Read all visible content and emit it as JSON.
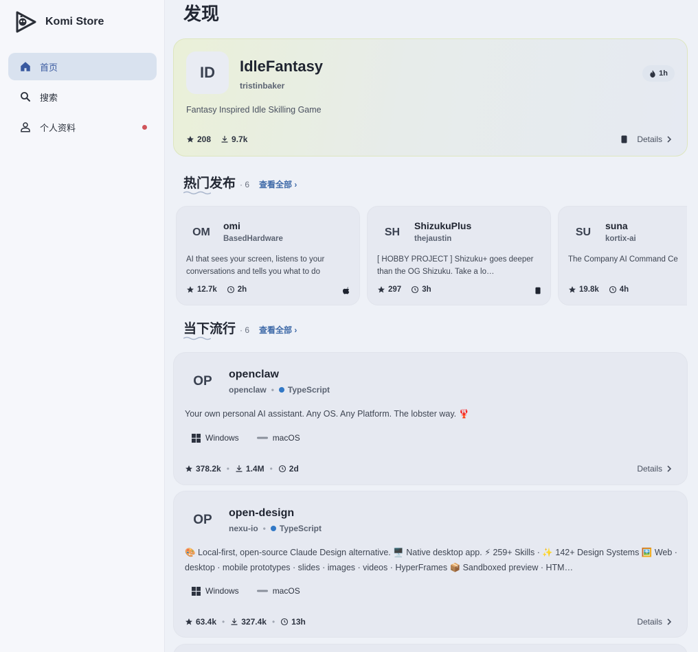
{
  "app": {
    "name": "Komi Store",
    "page_title": "发现"
  },
  "sidebar": {
    "items": [
      {
        "label": "首页",
        "icon": "home-icon",
        "active": true
      },
      {
        "label": "搜索",
        "icon": "search-icon",
        "active": false
      },
      {
        "label": "个人资料",
        "icon": "person-icon",
        "active": false,
        "badge_dot": true
      }
    ],
    "accent": "#3a5aa0",
    "badge_color": "#d0555b"
  },
  "hero": {
    "avatar": "ID",
    "name": "IdleFantasy",
    "owner": "tristinbaker",
    "badge": "1h",
    "description": "Fantasy Inspired Idle Skilling Game",
    "stars": "208",
    "downloads": "9.7k",
    "details": "Details"
  },
  "recent": {
    "title": "热门发布",
    "count": "· 6",
    "view_all": "查看全部 ›",
    "cards": [
      {
        "avatar": "OM",
        "name": "omi",
        "owner": "BasedHardware",
        "description": "AI that sees your screen, listens to your conversations and tells you what to do",
        "stars": "12.7k",
        "time": "2h",
        "platform_icon": "apple-icon"
      },
      {
        "avatar": "SH",
        "name": "ShizukuPlus",
        "owner": "thejaustin",
        "description": "[ HOBBY PROJECT ] Shizuku+ goes deeper than the OG Shizuku. Take a lo…",
        "stars": "297",
        "time": "3h",
        "platform_icon": "android-phone-icon"
      },
      {
        "avatar": "SU",
        "name": "suna",
        "owner": "kortix-ai",
        "description": "The Company AI Command Ce",
        "stars": "19.8k",
        "time": "4h",
        "platform_icon": ""
      }
    ]
  },
  "trending": {
    "title": "当下流行",
    "count": "· 6",
    "view_all": "查看全部 ›",
    "cards": [
      {
        "avatar": "OP",
        "name": "openclaw",
        "owner": "openclaw",
        "language": "TypeScript",
        "description": "Your own personal AI assistant. Any OS. Any Platform. The lobster way. 🦞",
        "platforms": [
          "Windows",
          "macOS"
        ],
        "stars": "378.2k",
        "downloads": "1.4M",
        "time": "2d",
        "details": "Details"
      },
      {
        "avatar": "OP",
        "name": "open-design",
        "owner": "nexu-io",
        "language": "TypeScript",
        "description": "🎨 Local-first, open-source Claude Design alternative. 🖥️ Native desktop app. ⚡ 259+ Skills · ✨ 142+ Design Systems 🖼️ Web · desktop · mobile prototypes · slides · images · videos · HyperFrames 📦 Sandboxed preview · HTM…",
        "platforms": [
          "Windows",
          "macOS"
        ],
        "stars": "63.4k",
        "downloads": "327.4k",
        "time": "13h",
        "details": "Details"
      }
    ]
  }
}
